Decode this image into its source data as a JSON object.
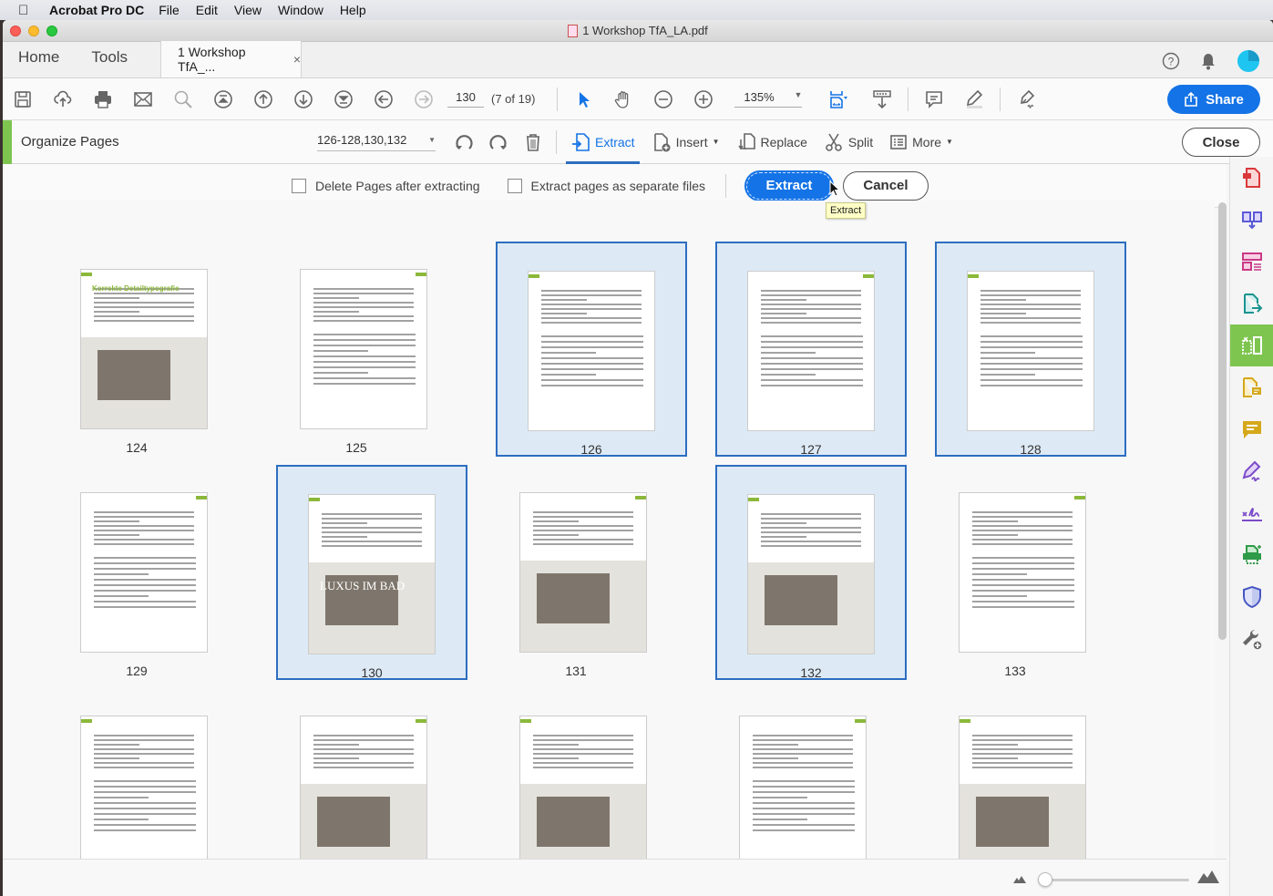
{
  "menubar": {
    "app": "Acrobat Pro DC",
    "items": [
      "File",
      "Edit",
      "View",
      "Window",
      "Help"
    ]
  },
  "window": {
    "title": "1  Workshop TfA_LA.pdf"
  },
  "tabs": {
    "home": "Home",
    "tools": "Tools",
    "document": "1  Workshop TfA_...",
    "close": "×"
  },
  "toolbar": {
    "page_number": "130",
    "page_of": "(7 of 19)",
    "zoom": "135%",
    "share": "Share"
  },
  "organize": {
    "title": "Organize Pages",
    "page_range": "126-128,130,132",
    "tools": [
      {
        "label": "Extract",
        "icon": "extract-icon"
      },
      {
        "label": "Insert",
        "icon": "insert-icon",
        "dropdown": true
      },
      {
        "label": "Replace",
        "icon": "replace-icon"
      },
      {
        "label": "Split",
        "icon": "scissors-icon"
      },
      {
        "label": "More",
        "icon": "more-icon",
        "dropdown": true
      }
    ],
    "close": "Close"
  },
  "extract_options": {
    "delete_pages": {
      "label": "Delete Pages after extracting",
      "checked": false
    },
    "separate_files": {
      "label": "Extract pages as separate files",
      "checked": false
    },
    "extract": "Extract",
    "cancel": "Cancel",
    "tooltip": "Extract"
  },
  "pages": [
    {
      "number": "124",
      "selected": false,
      "title": "Korrekte Detailtypografie"
    },
    {
      "number": "125",
      "selected": false
    },
    {
      "number": "126",
      "selected": true
    },
    {
      "number": "127",
      "selected": true
    },
    {
      "number": "128",
      "selected": true
    },
    {
      "number": "129",
      "selected": false
    },
    {
      "number": "130",
      "selected": true,
      "title": "LUXUS IM BAD"
    },
    {
      "number": "131",
      "selected": false
    },
    {
      "number": "132",
      "selected": true
    },
    {
      "number": "133",
      "selected": false
    },
    {
      "number": "",
      "selected": false
    },
    {
      "number": "",
      "selected": false
    },
    {
      "number": "",
      "selected": false
    },
    {
      "number": "",
      "selected": false
    },
    {
      "number": "",
      "selected": false
    }
  ],
  "thumbnail_zoom": {
    "value": 0.0
  },
  "colors": {
    "accent": "#1473e6",
    "organize": "#7ec550",
    "selection": "#ddeaf6"
  }
}
